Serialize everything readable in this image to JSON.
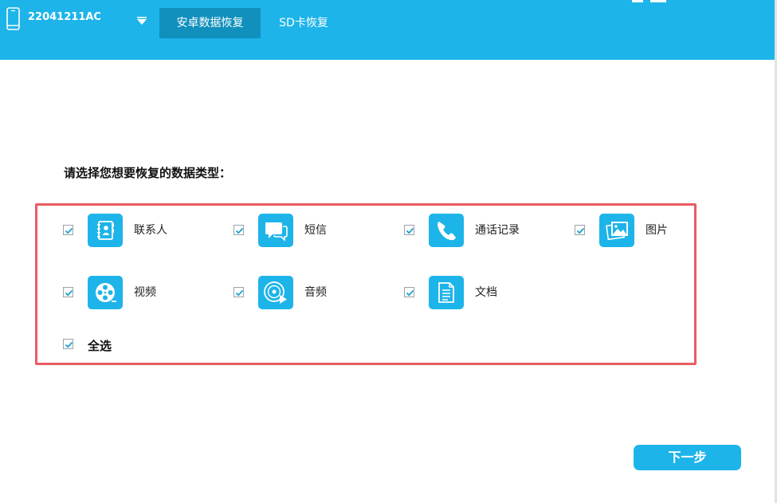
{
  "header": {
    "device_name": "22041211AC",
    "tabs": [
      {
        "label": "安卓数据恢复",
        "active": true
      },
      {
        "label": "SD卡恢复",
        "active": false
      }
    ]
  },
  "main": {
    "prompt": "请选择您想要恢复的数据类型：",
    "types": [
      {
        "label": "联系人",
        "icon": "contacts-icon",
        "checked": true
      },
      {
        "label": "短信",
        "icon": "messages-icon",
        "checked": true
      },
      {
        "label": "通话记录",
        "icon": "call-log-icon",
        "checked": true
      },
      {
        "label": "图片",
        "icon": "photos-icon",
        "checked": true
      },
      {
        "label": "视频",
        "icon": "video-icon",
        "checked": true
      },
      {
        "label": "音频",
        "icon": "audio-icon",
        "checked": true
      },
      {
        "label": "文档",
        "icon": "document-icon",
        "checked": true
      }
    ],
    "select_all": {
      "label": "全选",
      "checked": true
    }
  },
  "footer": {
    "next_label": "下一步"
  },
  "colors": {
    "accent": "#1db4e9",
    "active_tab": "#1190bd",
    "panel_border": "#e95c63"
  }
}
